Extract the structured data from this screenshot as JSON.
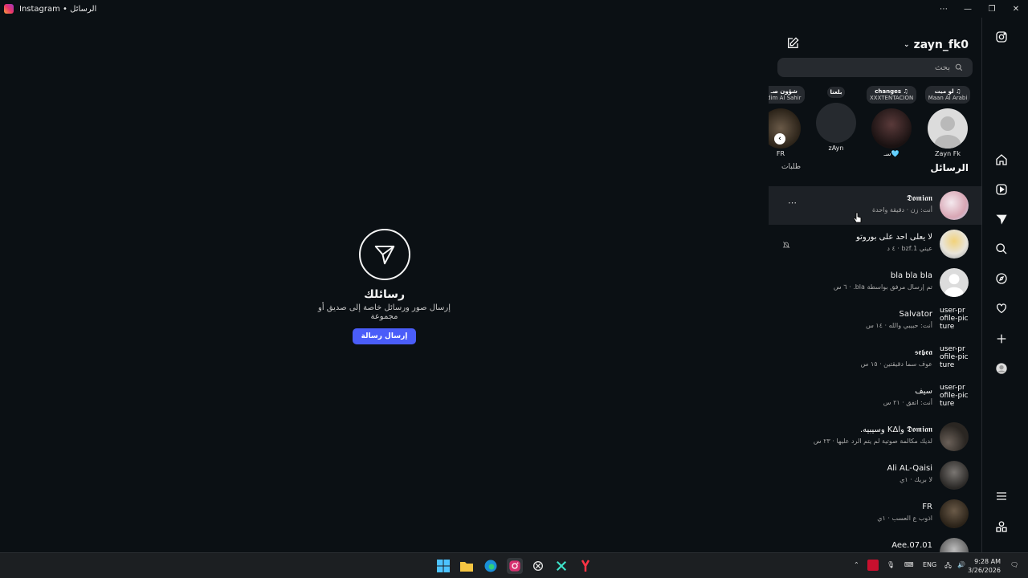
{
  "window": {
    "title": "Instagram • الرسائل"
  },
  "empty_state": {
    "title": "رسائلك",
    "subtitle": "إرسال صور ورسائل خاصة إلى صديق أو مجموعة",
    "button": "إرسال رسالة"
  },
  "panel": {
    "username": "zayn_fk0",
    "search_placeholder": "بحث",
    "section_title": "الرسائل",
    "requests_label": "طلبات",
    "stories": [
      {
        "note_title": "لو ميت ♫",
        "note_sub": "Maan Al Arabi",
        "name": "Zayn Fk"
      },
      {
        "note_title": "changes ♫",
        "note_sub": "XXXTENTACION",
        "name": "سـ🩵"
      },
      {
        "note_title": "بلعتا",
        "note_sub": "",
        "name": "zAyn"
      },
      {
        "note_title": "♫ شؤون صـ",
        "note_sub": "Kadim Al Sahir",
        "name": "FR"
      }
    ],
    "threads": [
      {
        "name": "𝕯𝖔𝖒𝖎𝖆𝖓",
        "sub": "أنت: زن · دقيقة واحدة",
        "avatar": ""
      },
      {
        "name": "لا يعلى احد على بوروتو",
        "sub": "عيني 1.bzf · ٤ د",
        "avatar": ""
      },
      {
        "name": "bla bla bla",
        "sub": "تم إرسال مرفق بواسطة bla. · ٦ س",
        "avatar": ""
      },
      {
        "name": "Salvator",
        "sub": "أنت: حبيبي والله · ١٤ س",
        "avatar": "user-profile-picture"
      },
      {
        "name": "𝖘𝖊𝖇𝖊𝖆",
        "sub": "عوف سما دقيقتين · ١٥ س",
        "avatar": "user-profile-picture"
      },
      {
        "name": "سيف",
        "sub": "أنت: اتفق · ٢١ س",
        "avatar": "user-profile-picture"
      },
      {
        "name": "𝕯𝖔𝖒𝖎𝖆𝖓 وKΔl وسيبيه.",
        "sub": "لديك مكالمة صوتية لم يتم الرد عليها · ٢٣ س",
        "avatar": ""
      },
      {
        "name": "Ali AL-Qaisi",
        "sub": "لا بريك · ١ي",
        "avatar": ""
      },
      {
        "name": "FR",
        "sub": "اذوب ع العسب · ١ي",
        "avatar": ""
      },
      {
        "name": "07.01.Aee",
        "sub": "",
        "avatar": ""
      }
    ]
  },
  "taskbar": {
    "lang": "ENG",
    "time": "9:28 AM",
    "date": "3/26/2026"
  }
}
